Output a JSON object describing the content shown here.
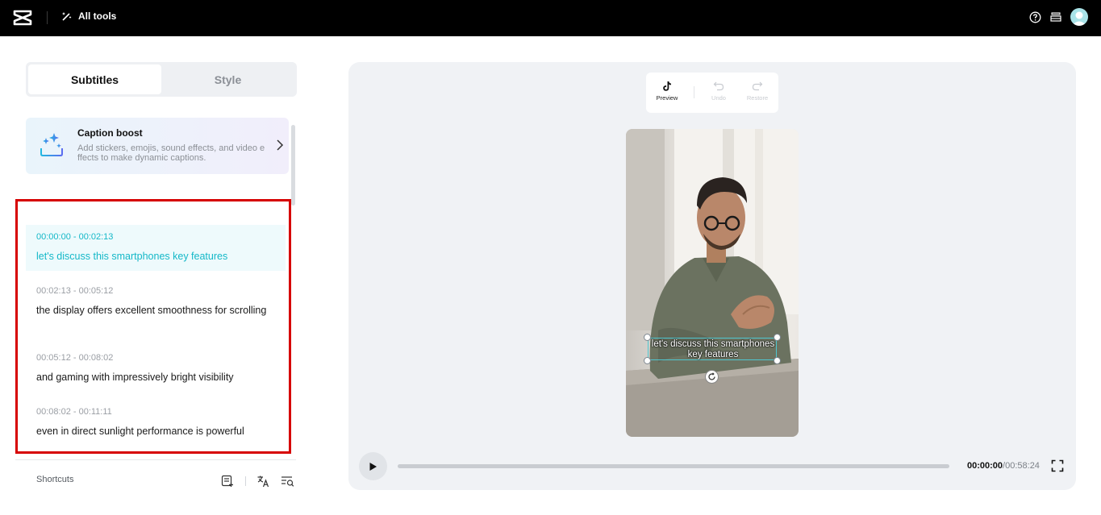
{
  "topbar": {
    "logo_icon": "capcut-logo-icon",
    "all_tools_label": "All tools",
    "icons": [
      "help-icon",
      "stack-icon",
      "avatar"
    ]
  },
  "tabs": [
    {
      "label": "Subtitles",
      "active": true
    },
    {
      "label": "Style",
      "active": false
    }
  ],
  "caption_boost": {
    "title": "Caption boost",
    "description": "Add stickers, emojis, sound effects, and video effects to make dynamic captions."
  },
  "subtitles": [
    {
      "time": "00:00:00 - 00:02:13",
      "text": "let's discuss this smartphones key features",
      "active": true
    },
    {
      "time": "00:02:13  - 00:05:12",
      "text": "the display offers excellent smoothness for scrolling",
      "active": false
    },
    {
      "time": "00:05:12  - 00:08:02",
      "text": "and gaming with impressively bright visibility",
      "active": false
    },
    {
      "time": "00:08:02 - 00:11:11",
      "text": "even in direct sunlight performance is powerful",
      "active": false
    }
  ],
  "bottom": {
    "shortcuts_label": "Shortcuts",
    "icons": [
      "subtitle-list-icon",
      "translate-icon",
      "search-list-icon"
    ]
  },
  "preview_toolbar": {
    "preview_label": "Preview",
    "undo_label": "Undo",
    "restore_label": "Restore"
  },
  "video": {
    "caption_text": "let's discuss this smartphones key features"
  },
  "player": {
    "current_time": "00:00:00",
    "separator": "/",
    "total_time": "00:58:24",
    "progress": 0
  },
  "colors": {
    "accent": "#14b8c8",
    "highlight_border": "#d60000",
    "topbar": "#000000"
  }
}
